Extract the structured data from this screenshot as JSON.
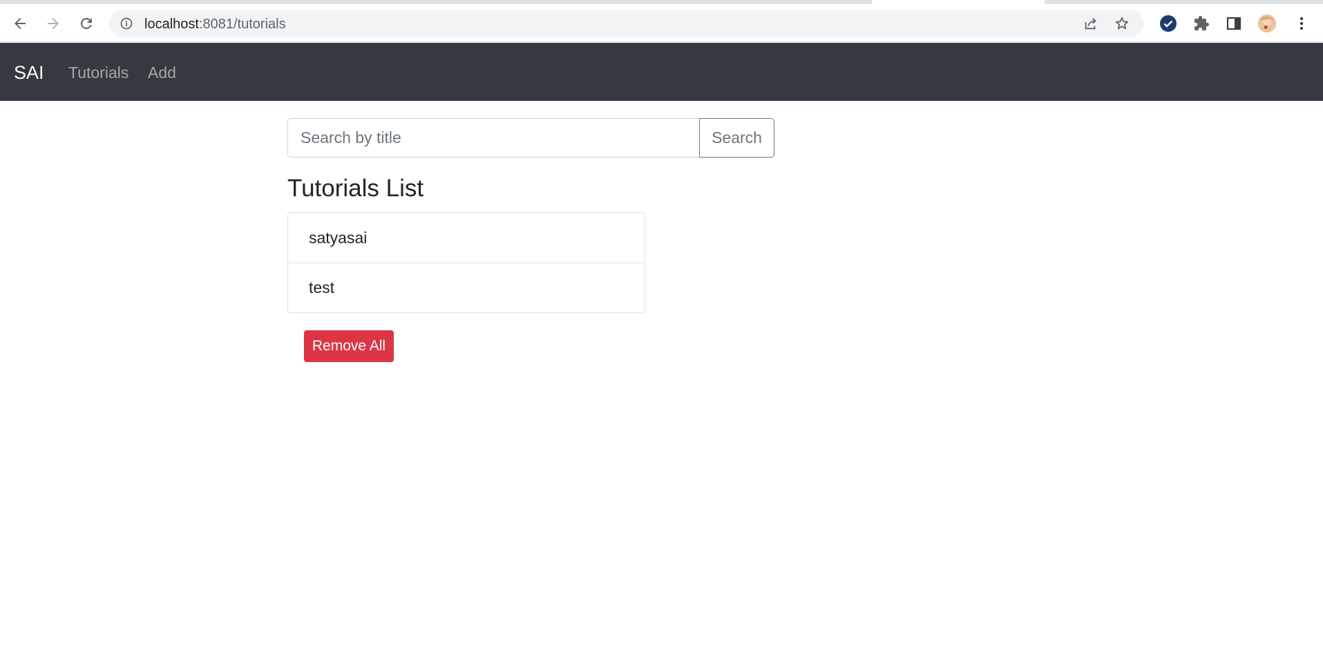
{
  "browser": {
    "url_host": "localhost",
    "url_rest": ":8081/tutorials",
    "icons": [
      "back-icon",
      "forward-icon",
      "reload-icon",
      "info-icon",
      "share-icon",
      "star-icon",
      "extension-check-icon",
      "puzzle-icon",
      "sidepanel-icon",
      "avatar",
      "menu-icon"
    ]
  },
  "navbar": {
    "brand": "SAI",
    "links": [
      "Tutorials",
      "Add"
    ]
  },
  "search": {
    "placeholder": "Search by title",
    "value": "",
    "button_label": "Search"
  },
  "tutorials": {
    "title": "Tutorials List",
    "items": [
      "satyasai",
      "test"
    ],
    "remove_all_label": "Remove All"
  },
  "colors": {
    "navbar_bg": "#343a40",
    "danger": "#dc3545"
  }
}
